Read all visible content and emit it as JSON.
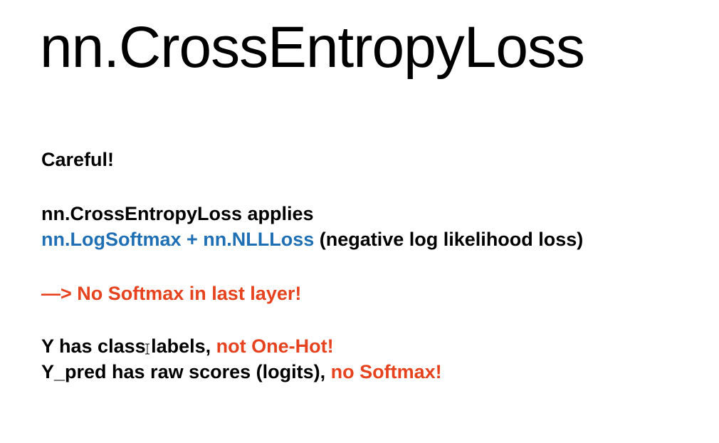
{
  "slide": {
    "title": "nn.CrossEntropyLoss",
    "careful": "Careful!",
    "applies_line": "nn.CrossEntropyLoss applies",
    "components_blue": "nn.LogSoftmax + nn.NLLLoss",
    "components_note": " (negative log likelihood loss)",
    "warning": "—> No Softmax in last layer!",
    "y_line_prefix": "Y has class labels, ",
    "y_line_highlight": "not One-Hot!",
    "ypred_line_prefix": "Y_pred has raw scores (logits), ",
    "ypred_line_highlight": "no Softmax!"
  },
  "colors": {
    "blue": "#1f6fb5",
    "red": "#e5421d"
  },
  "icons": {
    "cursor": "text-cursor-icon"
  }
}
